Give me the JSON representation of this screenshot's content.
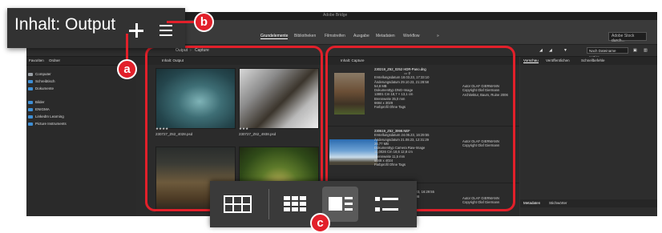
{
  "app": {
    "window_title": "Adobe Bridge",
    "workspace_tabs": [
      "Grundelemente",
      "Bibliotheken",
      "Filmstreifen",
      "Ausgabe",
      "Metadaten",
      "Workflow"
    ],
    "search_placeholder": "Adobe Stock durch...",
    "path": [
      "Output",
      "Capture"
    ],
    "sort_label": "Nach Dateiname sortier...",
    "left_panel": {
      "tabs": [
        "Favoriten",
        "Ordner"
      ],
      "favorites": [
        "Computer",
        "Schreibtisch",
        "Dokumente",
        "Bilder",
        "ENIGMA",
        "LinkedIn Learning",
        "Picture Instruments"
      ]
    },
    "content_panel": {
      "tab": "Inhalt: Output",
      "items": [
        {
          "filename": "230727_Z62_4028.psd",
          "rating": "★★★★"
        },
        {
          "filename": "230727_Z62_4938.psd",
          "rating": "★★★"
        },
        {
          "filename": "",
          "rating": ""
        },
        {
          "filename": "",
          "rating": ""
        }
      ]
    },
    "output_panel": {
      "tab": "Inhalt: Capture",
      "rows": [
        {
          "lines": [
            "230219_Z62_0252 HDR-Pano.dng",
            "Erstellungsdatum 18.03.23, 17:33:10",
            "Änderungsdatum 29.10.23, 21:28:58",
            "54,8 MB",
            "Dokumenttyp DNG-Image",
            "13801 Cm 18,7 × 13,1 cm",
            "Brennweite 35,0 mm",
            "6684 x 3029",
            "Farbprofil Ohne Tags"
          ],
          "right": [
            "Autor OLAF GIERMANN",
            "Copyright Olaf Giermann",
            "Architektur, Baum, Ruine 2006"
          ]
        },
        {
          "lines": [
            "230619_Z62_3998.NEF",
            "Erstellungsdatum 24.06.23, 16:29:55",
            "Änderungsdatum 21.08.23, 12:31:29",
            "26,77 MB",
            "Dokumenttyp Camera Raw-Image",
            "11,0026 Cm 18,6 12,8 cm",
            "Brennweite 11,5 mm",
            "6048 x 4024",
            "Farbprofil Ohne Tags"
          ],
          "right": [
            "Autor OLAF GIERMANN",
            "Copyright Olaf Giermann"
          ]
        },
        {
          "lines": [
            "230619_Z62_3999.NEF",
            "24.06.23, 16:29:55",
            "21:22:08",
            "Image"
          ],
          "right": [
            "Autor OLAF GIERMANN",
            "Copyright Olaf Giermann"
          ]
        }
      ]
    },
    "right_panel": {
      "tabs": [
        "Vorschau",
        "Veröffentlichen",
        "Schnellbefehle"
      ],
      "bottom_tabs": [
        "Metadaten",
        "Stichwörter"
      ]
    }
  },
  "callout": {
    "title": "Inhalt: Output",
    "badges": [
      "a",
      "b",
      "c"
    ]
  },
  "view_modes": {
    "items": [
      {
        "id": "grid",
        "icon": "grid-view-icon"
      },
      {
        "id": "thumbnails",
        "icon": "thumbnail-view-icon"
      },
      {
        "id": "details",
        "icon": "details-view-icon",
        "active": true
      },
      {
        "id": "list",
        "icon": "list-view-icon"
      }
    ]
  },
  "colors": {
    "highlight": "#e2202a",
    "panel_bg": "#323232",
    "folder": "#3d8fd6"
  }
}
